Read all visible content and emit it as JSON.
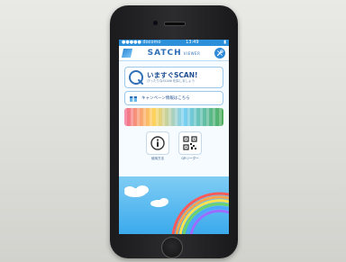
{
  "status": {
    "carrier": "●●●●● docomo",
    "time": "13:49",
    "battery": "▮"
  },
  "header": {
    "logo_main": "SATCH",
    "logo_sub": "VIEWER",
    "tool_icon": "tools-icon"
  },
  "scan": {
    "title": "いますぐSCAN!",
    "subtitle": "ぴったりなSCAN!を探しましょう"
  },
  "campaign": {
    "label": "キャンペーン情報はこちら"
  },
  "tiles": [
    {
      "label": "使用方法",
      "icon": "info-icon"
    },
    {
      "label": "QRリーダー",
      "icon": "qr-code-icon"
    }
  ],
  "colors": {
    "accent": "#2f8bd8",
    "sky_top": "#7fcdf4",
    "sky_bottom": "#3aa9ec"
  }
}
